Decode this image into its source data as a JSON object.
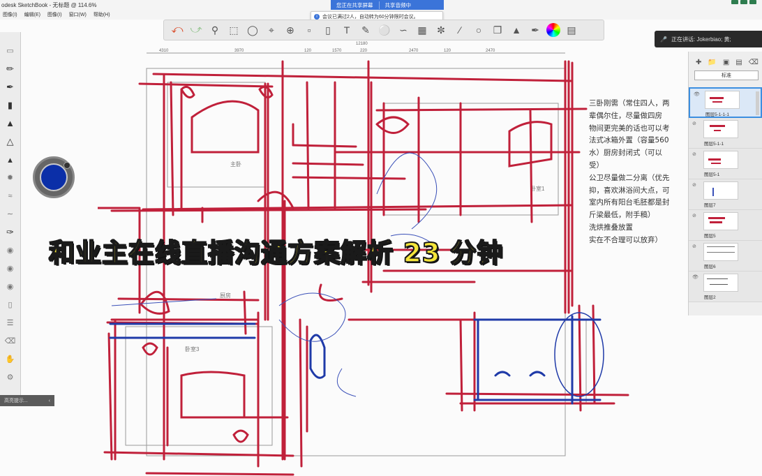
{
  "app": {
    "title": "odesk SketchBook - 无标题 @ 114.6%",
    "menu": [
      "图像(I)",
      "编辑(E)",
      "图像(I)",
      "窗口(W)",
      "帮助(H)"
    ]
  },
  "meeting": {
    "sharing_label": "您正在共享屏幕",
    "share_audio_label": "共享音频中",
    "notice": "会议已满过2人，自动转为60分钟限时会议。",
    "speaking": "正在讲话: Jokerbiao; 黄;"
  },
  "toolbar": {
    "icons": [
      "undo-icon",
      "redo-icon",
      "zoom-icon",
      "select-rect-icon",
      "lasso-icon",
      "crop-icon",
      "transform-icon",
      "distort-icon",
      "perspective-icon",
      "text-icon",
      "ruler-icon",
      "ellipse-guide-icon",
      "french-curve-icon",
      "perspective-grid-icon",
      "symmetry-icon",
      "line-icon",
      "oval-icon",
      "shape-icon",
      "fill-icon",
      "brushes-icon",
      "color-wheel-icon",
      "layers-icon"
    ]
  },
  "layers": {
    "blend_mode": "标准",
    "items": [
      {
        "name": "图层5-1-1-1",
        "selected": true
      },
      {
        "name": "图层5-1-1",
        "selected": false
      },
      {
        "name": "图层5-1",
        "selected": false
      },
      {
        "name": "图层7",
        "selected": false
      },
      {
        "name": "图层5",
        "selected": false
      },
      {
        "name": "图层6",
        "selected": false
      },
      {
        "name": "图层2",
        "selected": false
      }
    ]
  },
  "left_panel": {
    "preview_label": "高亮提示..."
  },
  "canvas": {
    "caption": "和业主在线直播沟通方案解析 23 分钟",
    "room_labels": [
      "主卧",
      "卧室1",
      "卧室3",
      "厨房"
    ],
    "dimension_labels": [
      "4310",
      "12180",
      "420",
      "3970",
      "120",
      "1570",
      "220",
      "2470",
      "120",
      "2470"
    ],
    "notes": [
      "三卧刚需（常住四人，两",
      "辈偶尔住，尽量做四房",
      "物间更完美的话也可以考",
      "法式冰箱外置（容量560",
      "水）厨房封闭式（可以",
      "受）",
      "公卫尽量做二分离（优先",
      "抑，喜欢淋浴间大点，可",
      "室内所有阳台毛胚都是封",
      "斤梁最低，附手稿）",
      "洗烘推叠放置",
      "",
      "",
      "实在不合理可以放弃）"
    ]
  },
  "colors": {
    "sketch_red": "#c0203a",
    "sketch_blue": "#1f3aa8",
    "caption_yellow": "#f5e63a"
  }
}
